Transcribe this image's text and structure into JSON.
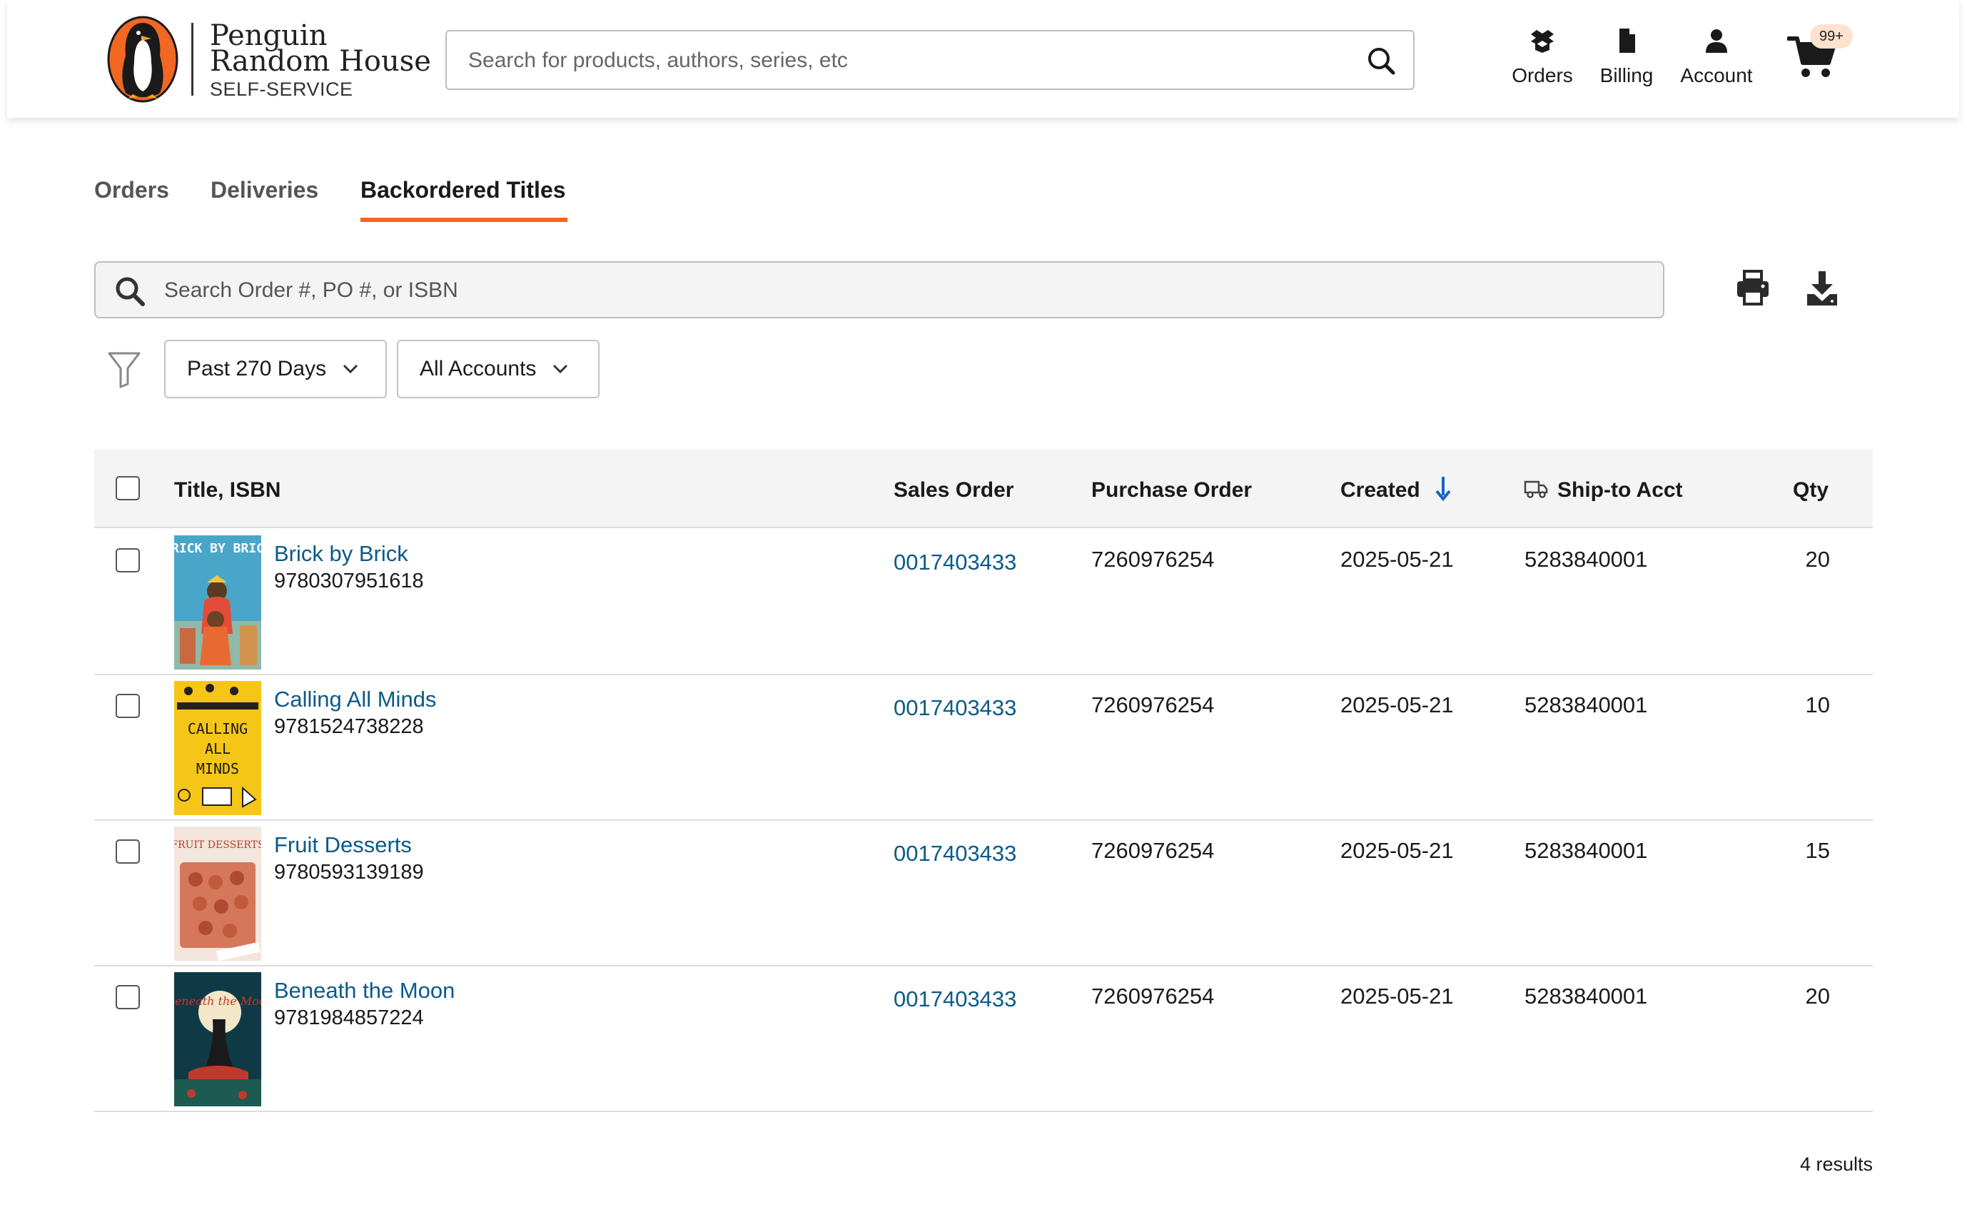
{
  "header": {
    "brand": {
      "line1": "Penguin",
      "line2": "Random House",
      "line3": "SELF-SERVICE",
      "logo_icon": "penguin-logo",
      "colors": {
        "orange": "#f26722",
        "black": "#1a1a1a"
      }
    },
    "search": {
      "placeholder": "Search for products, authors, series, etc",
      "icon": "search-icon"
    },
    "nav": [
      {
        "label": "Orders",
        "icon": "box-icon"
      },
      {
        "label": "Billing",
        "icon": "document-icon"
      },
      {
        "label": "Account",
        "icon": "user-icon"
      }
    ],
    "cart": {
      "icon": "cart-icon",
      "badge": "99+"
    }
  },
  "tabs": [
    {
      "label": "Orders",
      "active": false
    },
    {
      "label": "Deliveries",
      "active": false
    },
    {
      "label": "Backordered Titles",
      "active": true
    }
  ],
  "toolbar": {
    "search_placeholder": "Search Order #, PO #, or ISBN",
    "print_icon": "print-icon",
    "download_icon": "download-icon"
  },
  "filters": {
    "filter_icon": "filter-icon",
    "date_range": "Past 270 Days",
    "accounts": "All Accounts"
  },
  "table": {
    "columns": {
      "title_isbn": "Title, ISBN",
      "sales_order": "Sales Order",
      "purchase_order": "Purchase Order",
      "created": "Created",
      "ship_to": "Ship-to Acct",
      "qty": "Qty"
    },
    "sort": {
      "column": "Created",
      "direction": "descending"
    },
    "rows": [
      {
        "title": "Brick by Brick",
        "isbn": "9780307951618",
        "sales_order": "0017403433",
        "purchase_order": "7260976254",
        "created": "2025-05-21",
        "ship_to": "5283840001",
        "qty": "20",
        "cover_text": "BRICK BY BRICK"
      },
      {
        "title": "Calling All Minds",
        "isbn": "9781524738228",
        "sales_order": "0017403433",
        "purchase_order": "7260976254",
        "created": "2025-05-21",
        "ship_to": "5283840001",
        "qty": "10",
        "cover_text": "CALLING ALL MINDS"
      },
      {
        "title": "Fruit Desserts",
        "isbn": "9780593139189",
        "sales_order": "0017403433",
        "purchase_order": "7260976254",
        "created": "2025-05-21",
        "ship_to": "5283840001",
        "qty": "15",
        "cover_text": "FRUIT DESSERTS"
      },
      {
        "title": "Beneath the Moon",
        "isbn": "9781984857224",
        "sales_order": "0017403433",
        "purchase_order": "7260976254",
        "created": "2025-05-21",
        "ship_to": "5283840001",
        "qty": "20",
        "cover_text": "Beneath the Moon"
      }
    ]
  },
  "results_text": "4 results",
  "colors": {
    "accent": "#f26722",
    "link": "#0b5a87",
    "sort_arrow": "#1565c0"
  }
}
